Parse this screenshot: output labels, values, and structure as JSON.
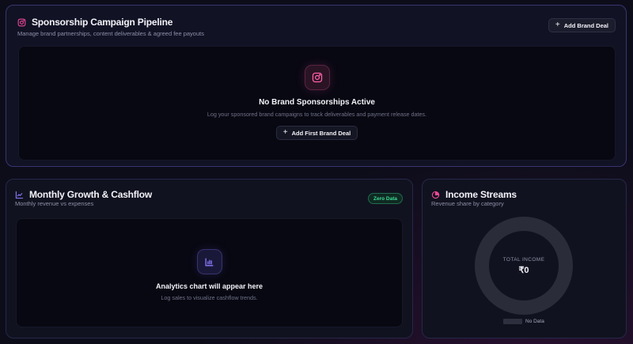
{
  "sponsorship": {
    "title": "Sponsorship Campaign Pipeline",
    "subtitle": "Manage brand partnerships, content deliverables & agreed fee payouts",
    "add_button": "Add Brand Deal",
    "empty_title": "No Brand Sponsorships Active",
    "empty_subtitle": "Log your sponsored brand campaigns to track deliverables and payment release dates.",
    "first_button": "Add First Brand Deal"
  },
  "growth": {
    "title": "Monthly Growth & Cashflow",
    "subtitle": "Monthly revenue vs expenses",
    "badge": "Zero Data",
    "empty_title": "Analytics chart will appear here",
    "empty_subtitle": "Log sales to visualize cashflow trends."
  },
  "income": {
    "title": "Income Streams",
    "subtitle": "Revenue share by category",
    "total_label": "TOTAL INCOME",
    "total_value": "₹0",
    "legend_label": "No Data"
  },
  "icons": {
    "sponsorship": "instagram-icon",
    "growth": "line-chart-icon",
    "income": "pie-chart-icon",
    "analytics": "bar-chart-icon"
  },
  "colors": {
    "accent_pink": "#ec4899",
    "accent_violet": "#7c6cff",
    "badge_green": "#3ddc97",
    "background": "#0b0b16"
  }
}
